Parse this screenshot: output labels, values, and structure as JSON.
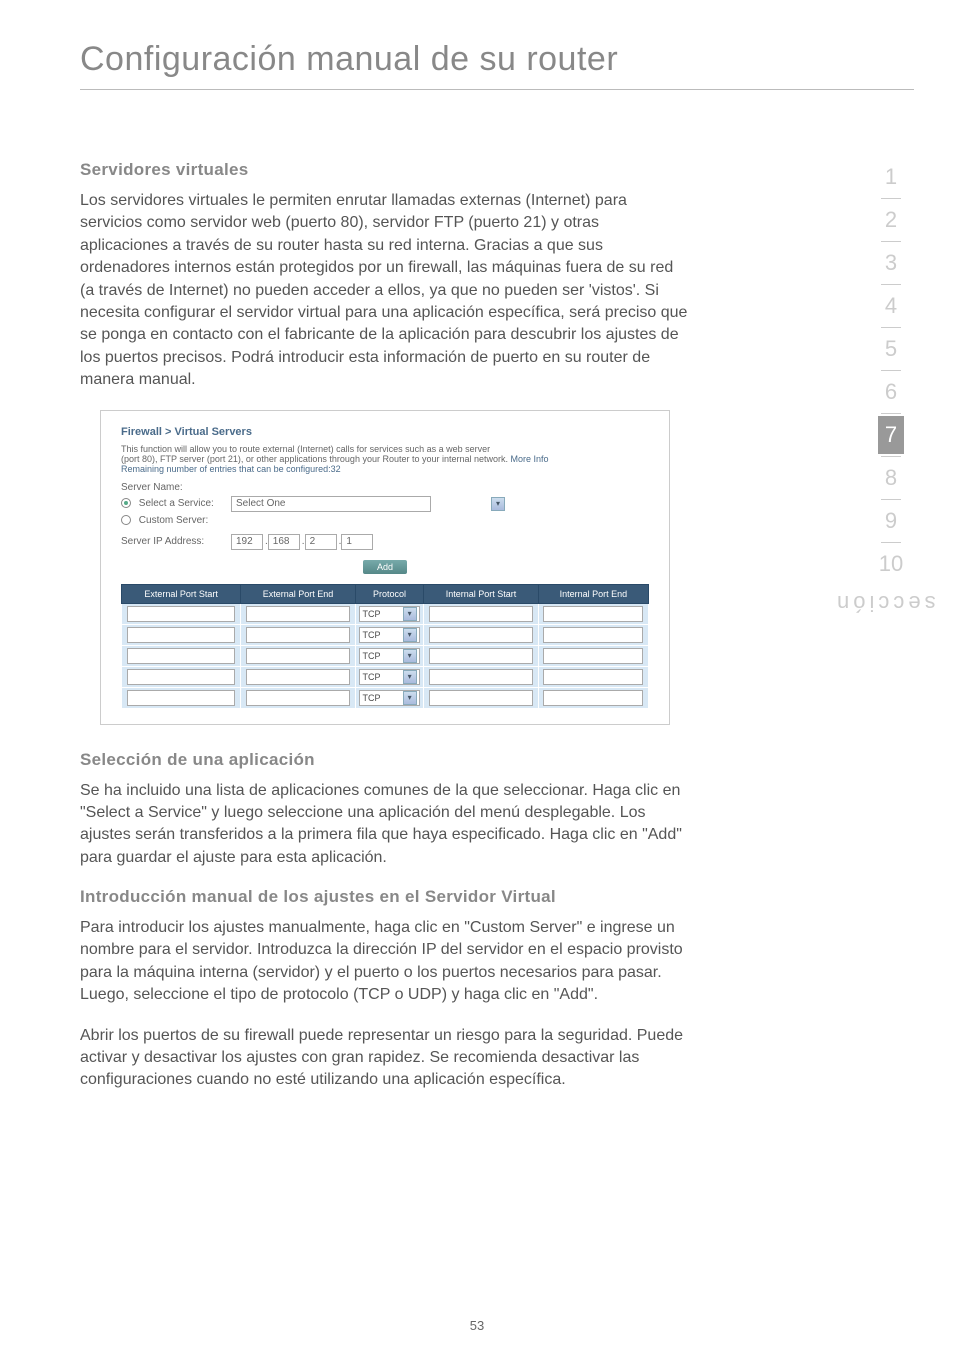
{
  "page": {
    "title": "Configuración manual de su router",
    "number": "53",
    "side_label": "sección"
  },
  "nav": {
    "items": [
      "1",
      "2",
      "3",
      "4",
      "5",
      "6",
      "7",
      "8",
      "9",
      "10"
    ],
    "active_index": 6
  },
  "sec1": {
    "heading": "Servidores virtuales",
    "body": "Los servidores virtuales le permiten enrutar llamadas externas (Internet) para servicios como servidor web (puerto 80), servidor FTP (puerto 21) y otras aplicaciones a través de su router hasta su red interna. Gracias a que sus ordenadores internos están protegidos por un firewall, las máquinas fuera de su red (a través de Internet) no pueden acceder a ellos, ya que no pueden ser 'vistos'. Si necesita configurar el servidor virtual para una aplicación específica, será preciso que se ponga en contacto con el fabricante de la aplicación para descubrir los ajustes de los puertos precisos. Podrá introducir esta información de puerto en su router de manera manual."
  },
  "shot": {
    "breadcrumb": "Firewall > Virtual Servers",
    "desc1": "This function will allow you to route external (Internet) calls for services such as a web server",
    "desc2": "(port 80), FTP server (port 21), or other applications through your Router to your internal network. ",
    "more_info": "More Info",
    "remaining": "Remaining number of entries that can be configured:32",
    "server_name_label": "Server Name:",
    "select_service_label": "Select a Service:",
    "select_service_value": "Select One",
    "custom_server_label": "Custom Server:",
    "server_ip_label": "Server IP Address:",
    "ip": [
      "192",
      "168",
      "2",
      "1"
    ],
    "add_label": "Add",
    "headers": {
      "c1": "External Port Start",
      "c2": "External Port End",
      "c3": "Protocol",
      "c4": "Internal Port Start",
      "c5": "Internal Port End"
    },
    "proto_value": "TCP"
  },
  "sec2": {
    "heading": "Selección de una aplicación",
    "body": "Se ha incluido una lista de aplicaciones comunes de la que seleccionar. Haga clic en \"Select a Service\" y luego seleccione una aplicación del menú desplegable. Los ajustes serán transferidos a la primera fila que haya especificado. Haga clic en \"Add\" para guardar el ajuste para esta aplicación."
  },
  "sec3": {
    "heading": "Introducción manual de los ajustes en el Servidor Virtual",
    "body1": "Para introducir los ajustes manualmente, haga clic en \"Custom Server\" e ingrese un nombre para el servidor. Introduzca la dirección IP del servidor en el espacio provisto para la máquina interna (servidor) y el puerto o los puertos necesarios para pasar. Luego, seleccione el tipo de protocolo (TCP o UDP) y haga clic en \"Add\".",
    "body2": "Abrir los puertos de su firewall puede representar un riesgo para la seguridad. Puede activar y desactivar los ajustes con gran rapidez. Se recomienda desactivar las configuraciones cuando no esté utilizando una aplicación específica."
  }
}
